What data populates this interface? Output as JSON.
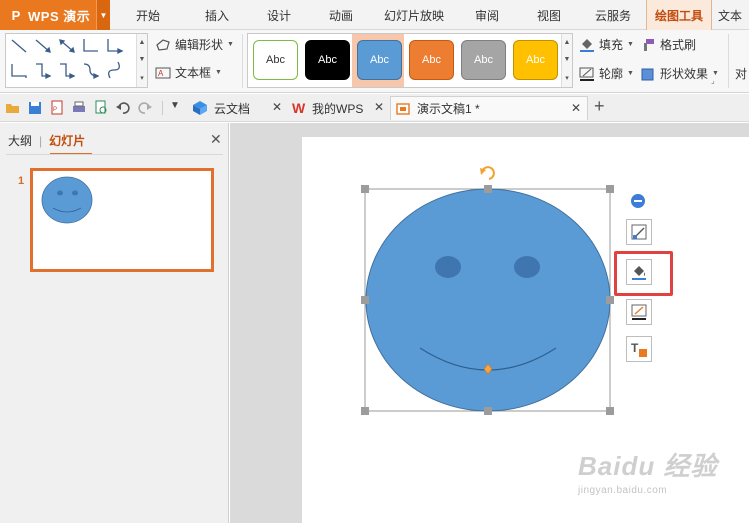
{
  "app": {
    "name": "WPS 演示",
    "logo": "P"
  },
  "menu_tabs": [
    {
      "label": "开始",
      "active": false
    },
    {
      "label": "插入",
      "active": false
    },
    {
      "label": "设计",
      "active": false
    },
    {
      "label": "动画",
      "active": false
    },
    {
      "label": "幻灯片放映",
      "active": false
    },
    {
      "label": "审阅",
      "active": false
    },
    {
      "label": "视图",
      "active": false
    },
    {
      "label": "云服务",
      "active": false
    },
    {
      "label": "绘图工具",
      "active": true
    },
    {
      "label": "文本工",
      "active": false
    }
  ],
  "ribbon": {
    "edit_shape": "编辑形状",
    "text_box": "文本框",
    "style_presets": [
      {
        "label": "Abc",
        "bg": "#ffffff",
        "border": "#7dbb42",
        "text": "#333333"
      },
      {
        "label": "Abc",
        "bg": "#000000",
        "border": "#000000",
        "text": "#ffffff"
      },
      {
        "label": "Abc",
        "bg": "#5b9bd5",
        "border": "#41719c",
        "text": "#ffffff"
      },
      {
        "label": "Abc",
        "bg": "#ed7d31",
        "border": "#c55a11",
        "text": "#ffffff"
      },
      {
        "label": "Abc",
        "bg": "#a5a5a5",
        "border": "#7f7f7f",
        "text": "#ffffff"
      },
      {
        "label": "Abc",
        "bg": "#ffc000",
        "border": "#bf9000",
        "text": "#ffffff"
      }
    ],
    "fill": "填充",
    "format_painter": "格式刷",
    "outline": "轮廓",
    "shape_effects": "形状效果",
    "cut_label": "对"
  },
  "doc_tabs": [
    {
      "label": "云文档",
      "icon": "cloud-doc-icon",
      "active": false
    },
    {
      "label": "我的WPS",
      "icon": "wps-w-icon",
      "active": false
    },
    {
      "label": "演示文稿1 *",
      "icon": "presentation-icon",
      "active": true
    }
  ],
  "left_panel": {
    "tab_outline": "大纲",
    "tab_slides": "幻灯片",
    "slide_number": "1"
  },
  "colors": {
    "accent": "#e9781f",
    "shape_fill": "#5b9bd5",
    "shape_stroke": "#41719c",
    "highlight": "#e04242"
  },
  "watermark": {
    "brand": "Baidu 经验",
    "url": "jingyan.baidu.com"
  }
}
